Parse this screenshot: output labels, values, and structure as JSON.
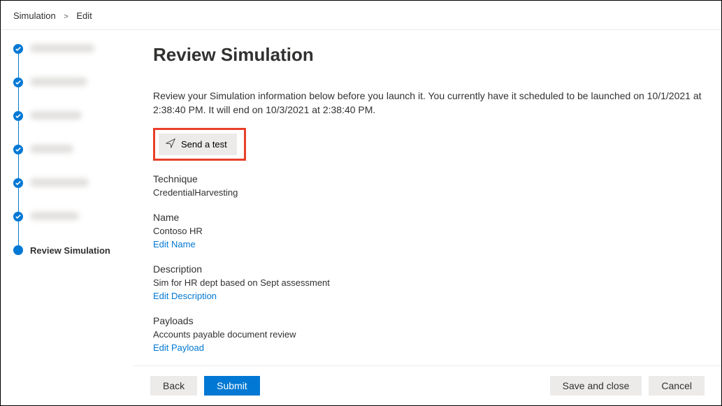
{
  "breadcrumb": {
    "parent": "Simulation",
    "current": "Edit"
  },
  "sidebar": {
    "steps": [
      {
        "state": "done",
        "blurWidth": 92
      },
      {
        "state": "done",
        "blurWidth": 82
      },
      {
        "state": "done",
        "blurWidth": 74
      },
      {
        "state": "done",
        "blurWidth": 62
      },
      {
        "state": "done",
        "blurWidth": 84
      },
      {
        "state": "done",
        "blurWidth": 70
      }
    ],
    "current_label": "Review Simulation"
  },
  "main": {
    "title": "Review Simulation",
    "description": "Review your Simulation information below before you launch it. You currently have it scheduled to be launched on 10/1/2021 at 2:38:40 PM. It will end on 10/3/2021 at 2:38:40 PM.",
    "send_test_label": "Send a test",
    "technique": {
      "label": "Technique",
      "value": "CredentialHarvesting"
    },
    "name": {
      "label": "Name",
      "value": "Contoso HR",
      "edit_link": "Edit Name"
    },
    "desc_section": {
      "label": "Description",
      "value": "Sim for HR dept based on Sept assessment",
      "edit_link": "Edit Description"
    },
    "payloads": {
      "label": "Payloads",
      "value": "Accounts payable document review",
      "edit_link": "Edit Payload"
    }
  },
  "footer": {
    "back": "Back",
    "submit": "Submit",
    "save_close": "Save and close",
    "cancel": "Cancel"
  }
}
